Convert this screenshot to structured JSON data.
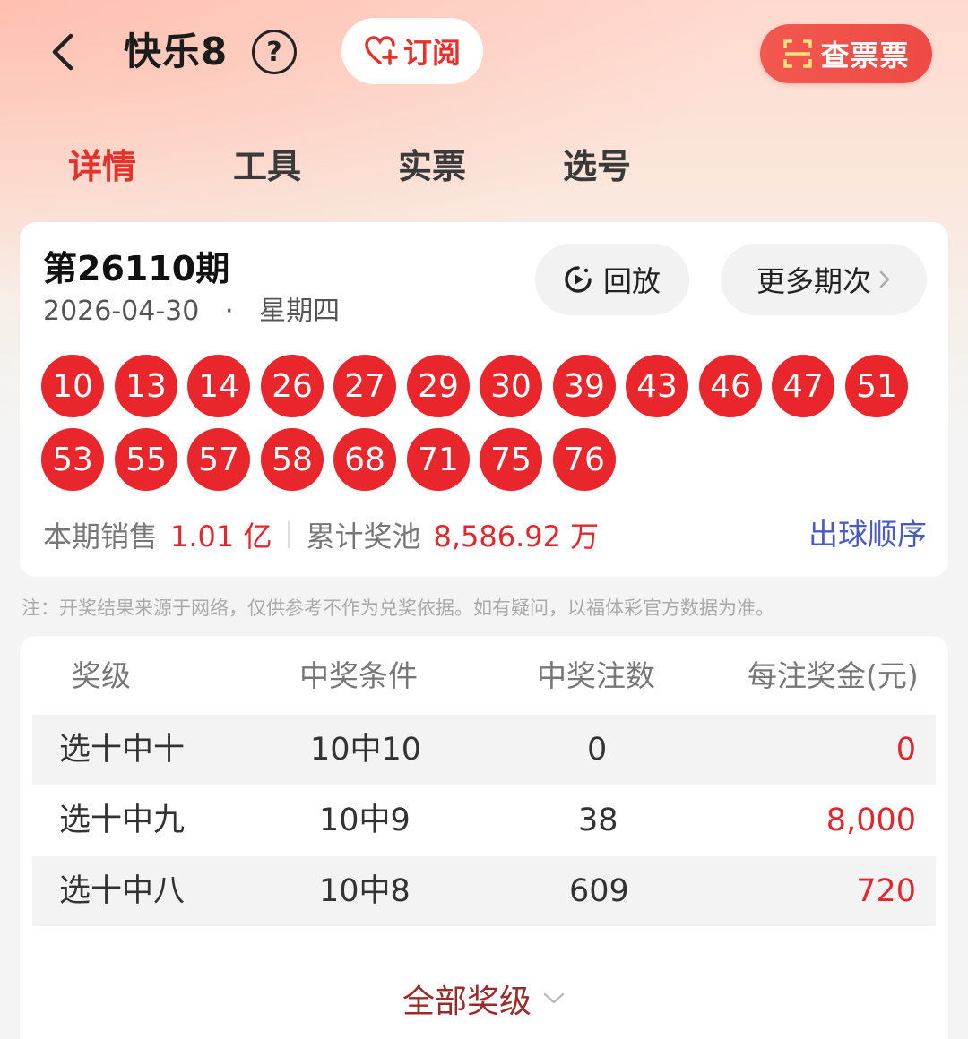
{
  "header": {
    "title": "快乐8",
    "help_symbol": "?",
    "subscribe_label": "订阅",
    "check_ticket_label": "查票票"
  },
  "tabs": [
    {
      "label": "详情",
      "active": true
    },
    {
      "label": "工具",
      "active": false
    },
    {
      "label": "实票",
      "active": false
    },
    {
      "label": "选号",
      "active": false
    }
  ],
  "draw": {
    "issue": "第26110期",
    "date": "2026-04-30",
    "separator": "·",
    "weekday": "星期四",
    "replay_label": "回放",
    "more_label": "更多期次",
    "numbers": [
      "10",
      "13",
      "14",
      "26",
      "27",
      "29",
      "30",
      "39",
      "43",
      "46",
      "47",
      "51",
      "53",
      "55",
      "57",
      "58",
      "68",
      "71",
      "75",
      "76"
    ],
    "sales_label": "本期销售",
    "sales_value": "1.01 亿",
    "pool_label": "累计奖池",
    "pool_value": "8,586.92 万",
    "order_link": "出球顺序"
  },
  "note": "注：开奖结果来源于网络，仅供参考不作为兑奖依据。如有疑问，以福体彩官方数据为准。",
  "prize_table": {
    "headers": [
      "奖级",
      "中奖条件",
      "中奖注数",
      "每注奖金(元)"
    ],
    "rows": [
      {
        "level": "选十中十",
        "condition": "10中10",
        "count": "0",
        "amount": "0"
      },
      {
        "level": "选十中九",
        "condition": "10中9",
        "count": "38",
        "amount": "8,000"
      },
      {
        "level": "选十中八",
        "condition": "10中8",
        "count": "609",
        "amount": "720"
      }
    ],
    "all_levels_label": "全部奖级"
  },
  "colors": {
    "accent_red": "#e8302d",
    "ball_red": "#e8262b",
    "link_blue": "#4a5bc4",
    "all_levels_text": "#9b2a2a"
  }
}
